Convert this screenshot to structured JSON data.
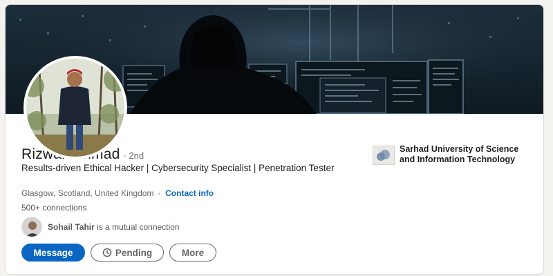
{
  "profile": {
    "name": "Rizwan Ahmad",
    "degree": "· 2nd",
    "headline": "Results-driven Ethical Hacker | Cybersecurity Specialist | Penetration Tester",
    "location": "Glasgow, Scotland, United Kingdom",
    "separator": "·",
    "contact_info": "Contact info",
    "connections": "500+ connections"
  },
  "mutual": {
    "name": "Sohail Tahir",
    "text": " is a mutual connection"
  },
  "actions": {
    "message": "Message",
    "pending": "Pending",
    "more": "More"
  },
  "education": {
    "name": "Sarhad University of Science and Information Technology"
  },
  "icons": {
    "pending": "clock-icon",
    "education_logo": "university-logo-icon"
  },
  "colors": {
    "primary": "#0a66c2",
    "text": "#1f1f1f",
    "muted": "#666666",
    "banner": "#16252f"
  }
}
